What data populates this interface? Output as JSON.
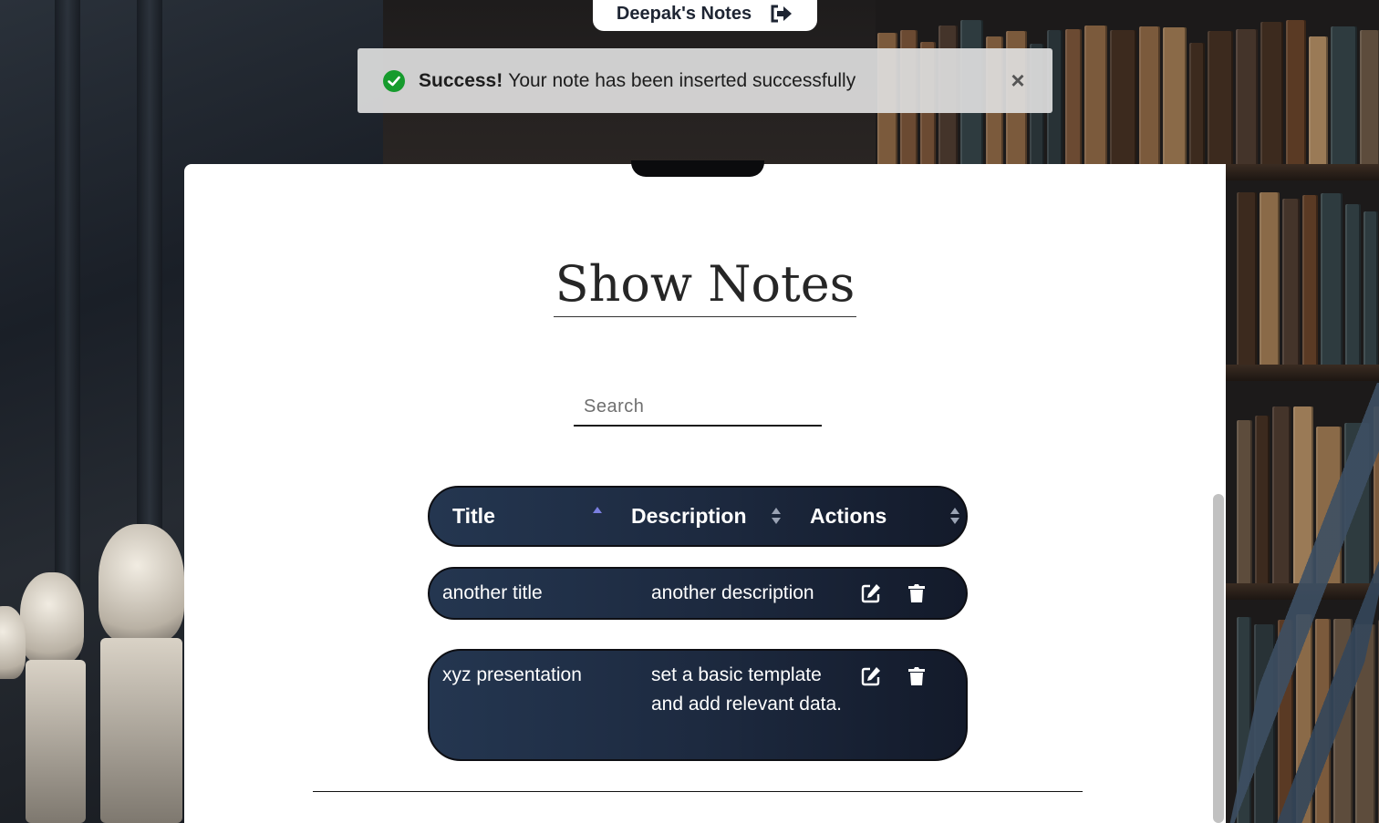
{
  "navbar": {
    "brand": "Deepak's Notes",
    "logout_icon": "sign-out-icon"
  },
  "alert": {
    "type": "success",
    "strong": "Success!",
    "message": "Your note has been inserted successfully",
    "icon": "check-circle-icon",
    "close_icon": "close-icon",
    "color": "#169b2d"
  },
  "page": {
    "title": "Show Notes"
  },
  "search": {
    "placeholder": "Search",
    "value": ""
  },
  "table": {
    "columns": [
      {
        "label": "Title",
        "sort": "ascending"
      },
      {
        "label": "Description",
        "sort": "none"
      },
      {
        "label": "Actions",
        "sort": "none"
      }
    ],
    "rows": [
      {
        "title": "another title",
        "description": "another description"
      },
      {
        "title": "xyz presentation",
        "description": "set a basic template and add relevant data."
      }
    ],
    "row_actions": [
      "edit-icon",
      "trash-icon"
    ],
    "accent": "#7a7fe0"
  }
}
